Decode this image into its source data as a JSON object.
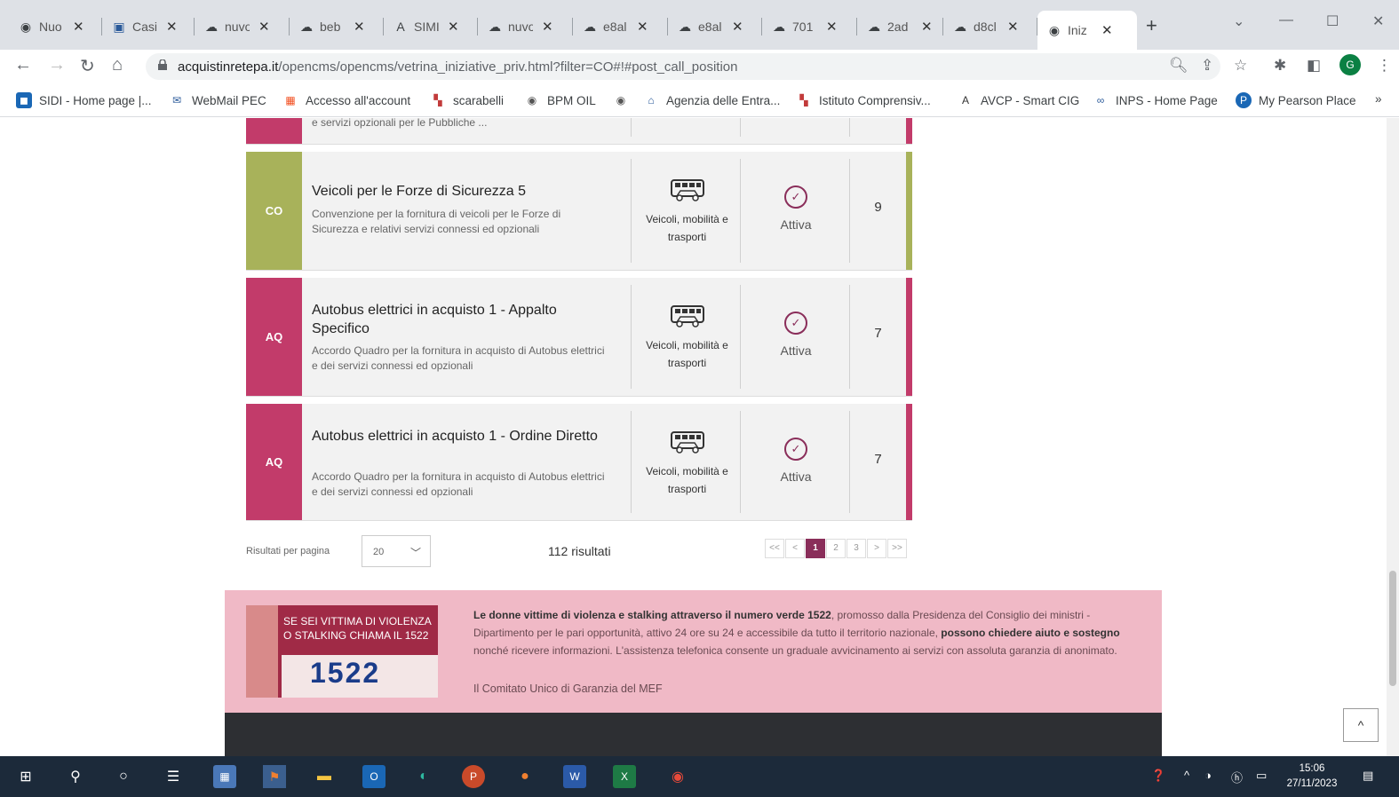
{
  "browser": {
    "tabs": [
      {
        "label": "Nuo",
        "icon": "chrome-icon"
      },
      {
        "label": "Casi",
        "icon": "app-icon"
      },
      {
        "label": "nuvo",
        "icon": "cloud-icon"
      },
      {
        "label": "beb",
        "icon": "cloud-icon"
      },
      {
        "label": "SIMI",
        "icon": "a-logo-icon"
      },
      {
        "label": "nuvo",
        "icon": "cloud-icon"
      },
      {
        "label": "e8al",
        "icon": "cloud-icon"
      },
      {
        "label": "e8al",
        "icon": "cloud-icon"
      },
      {
        "label": "701",
        "icon": "cloud-icon"
      },
      {
        "label": "2ad",
        "icon": "cloud-icon"
      },
      {
        "label": "d8cl",
        "icon": "cloud-icon"
      },
      {
        "label": "Iniz",
        "icon": "chrome-icon",
        "active": true
      }
    ],
    "new_tab": "+",
    "url_domain": "acquistinretepa.it",
    "url_path": "/opencms/opencms/vetrina_iniziative_priv.html?filter=CO#!#post_call_position",
    "profile_initial": "G",
    "bookmarks": [
      {
        "label": "SIDI - Home page |..."
      },
      {
        "label": "WebMail PEC"
      },
      {
        "label": "Accesso all'account"
      },
      {
        "label": "scarabelli"
      },
      {
        "label": "BPM OIL"
      },
      {
        "label": ""
      },
      {
        "label": "Agenzia delle Entra..."
      },
      {
        "label": "Istituto Comprensiv..."
      },
      {
        "label": "AVCP - Smart CIG"
      },
      {
        "label": "INPS - Home Page"
      },
      {
        "label": "My Pearson Place"
      }
    ],
    "bookmarks_more": "»"
  },
  "page": {
    "partial_card_desc": "e servizi opzionali per le Pubbliche ...",
    "cards": [
      {
        "badge": "CO",
        "title": "Veicoli per le Forze di Sicurezza 5",
        "desc": "Convenzione per la fornitura di veicoli per le Forze di Sicurezza e relativi servizi connessi ed opzionali",
        "category": "Veicoli, mobilità e trasporti",
        "status": "Attiva",
        "count": "9"
      },
      {
        "badge": "AQ",
        "title": "Autobus elettrici in acquisto 1 - Appalto Specifico",
        "desc": "Accordo Quadro per la fornitura in acquisto di Autobus elettrici e dei servizi connessi ed opzionali",
        "category": "Veicoli, mobilità e trasporti",
        "status": "Attiva",
        "count": "7"
      },
      {
        "badge": "AQ",
        "title": "Autobus elettrici in acquisto 1 - Ordine Diretto",
        "desc": "Accordo Quadro per la fornitura in acquisto di Autobus elettrici e dei servizi connessi ed opzionali",
        "category": "Veicoli, mobilità e trasporti",
        "status": "Attiva",
        "count": "7"
      }
    ],
    "pagination": {
      "per_page_label": "Risultati per pagina",
      "per_page_value": "20",
      "results": "112 risultati",
      "pages": [
        "<<",
        "<",
        "1",
        "2",
        "3",
        ">",
        ">>"
      ],
      "current_page": "1"
    },
    "banner": {
      "poster_line1": "SE SEI VITTIMA DI VIOLENZA",
      "poster_line2": "O STALKING CHIAMA IL 1522",
      "poster_number": "1522",
      "text_bold1": "Le donne vittime di violenza e stalking attraverso il numero verde 1522",
      "text_normal1": ", promosso dalla Presidenza del Consiglio dei ministri - Dipartimento per le pari opportunità, attivo 24 ore su 24 e accessibile da tutto il territorio nazionale, ",
      "text_bold2": "possono chiedere aiuto e sostegno",
      "text_normal2": " nonché ricevere informazioni. L'assistenza telefonica consente un graduale avvicinamento ai servizi con assoluta garanzia di anonimato.",
      "signature": "Il Comitato Unico di Garanzia del MEF"
    },
    "back_to_top": "^"
  },
  "taskbar": {
    "time": "15:06",
    "date": "27/11/2023"
  },
  "colors": {
    "co_green": "#a8b25a",
    "aq_magenta": "#c23b6a",
    "status_purple": "#8a2e5a",
    "banner_pink": "#f0b9c6"
  }
}
